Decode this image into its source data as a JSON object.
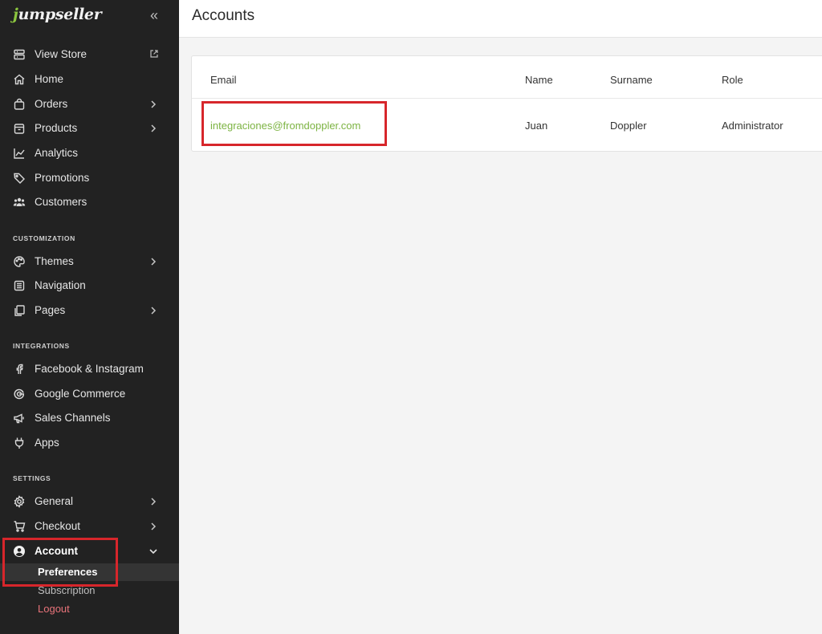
{
  "brand": {
    "name": "umpseller",
    "leaf_letter": "j",
    "leaf_color": "#8cc63f"
  },
  "sidebar": {
    "primary": [
      {
        "label": "View Store",
        "icon": "store-icon",
        "external": true
      },
      {
        "label": "Home",
        "icon": "home-icon"
      },
      {
        "label": "Orders",
        "icon": "bag-icon",
        "arrow": true
      },
      {
        "label": "Products",
        "icon": "box-icon",
        "arrow": true
      },
      {
        "label": "Analytics",
        "icon": "chart-icon"
      },
      {
        "label": "Promotions",
        "icon": "tag-icon"
      },
      {
        "label": "Customers",
        "icon": "users-icon"
      }
    ],
    "customization": {
      "title": "CUSTOMIZATION",
      "items": [
        {
          "label": "Themes",
          "icon": "palette-icon",
          "arrow": true
        },
        {
          "label": "Navigation",
          "icon": "list-icon"
        },
        {
          "label": "Pages",
          "icon": "pages-icon",
          "arrow": true
        }
      ]
    },
    "integrations": {
      "title": "INTEGRATIONS",
      "items": [
        {
          "label": "Facebook & Instagram",
          "icon": "facebook-icon"
        },
        {
          "label": "Google Commerce",
          "icon": "google-icon"
        },
        {
          "label": "Sales Channels",
          "icon": "megaphone-icon"
        },
        {
          "label": "Apps",
          "icon": "plug-icon"
        }
      ]
    },
    "settings": {
      "title": "SETTINGS",
      "items": [
        {
          "label": "General",
          "icon": "gear-icon",
          "arrow": true
        },
        {
          "label": "Checkout",
          "icon": "cart-icon",
          "arrow": true
        },
        {
          "label": "Account",
          "icon": "user-circle-icon",
          "expanded": true
        }
      ],
      "account_sub": [
        {
          "label": "Preferences",
          "selected": true
        },
        {
          "label": "Subscription"
        },
        {
          "label": "Logout"
        }
      ]
    }
  },
  "main": {
    "title": "Accounts",
    "table": {
      "headers": [
        "Email",
        "Name",
        "Surname",
        "Role"
      ],
      "rows": [
        [
          "integraciones@fromdoppler.com",
          "Juan",
          "Doppler",
          "Administrator"
        ]
      ]
    }
  },
  "colors": {
    "sidebar_bg": "#222222",
    "accent_green": "#7cb342",
    "highlight_red": "#d7262b",
    "logout_red": "#e8737a"
  }
}
